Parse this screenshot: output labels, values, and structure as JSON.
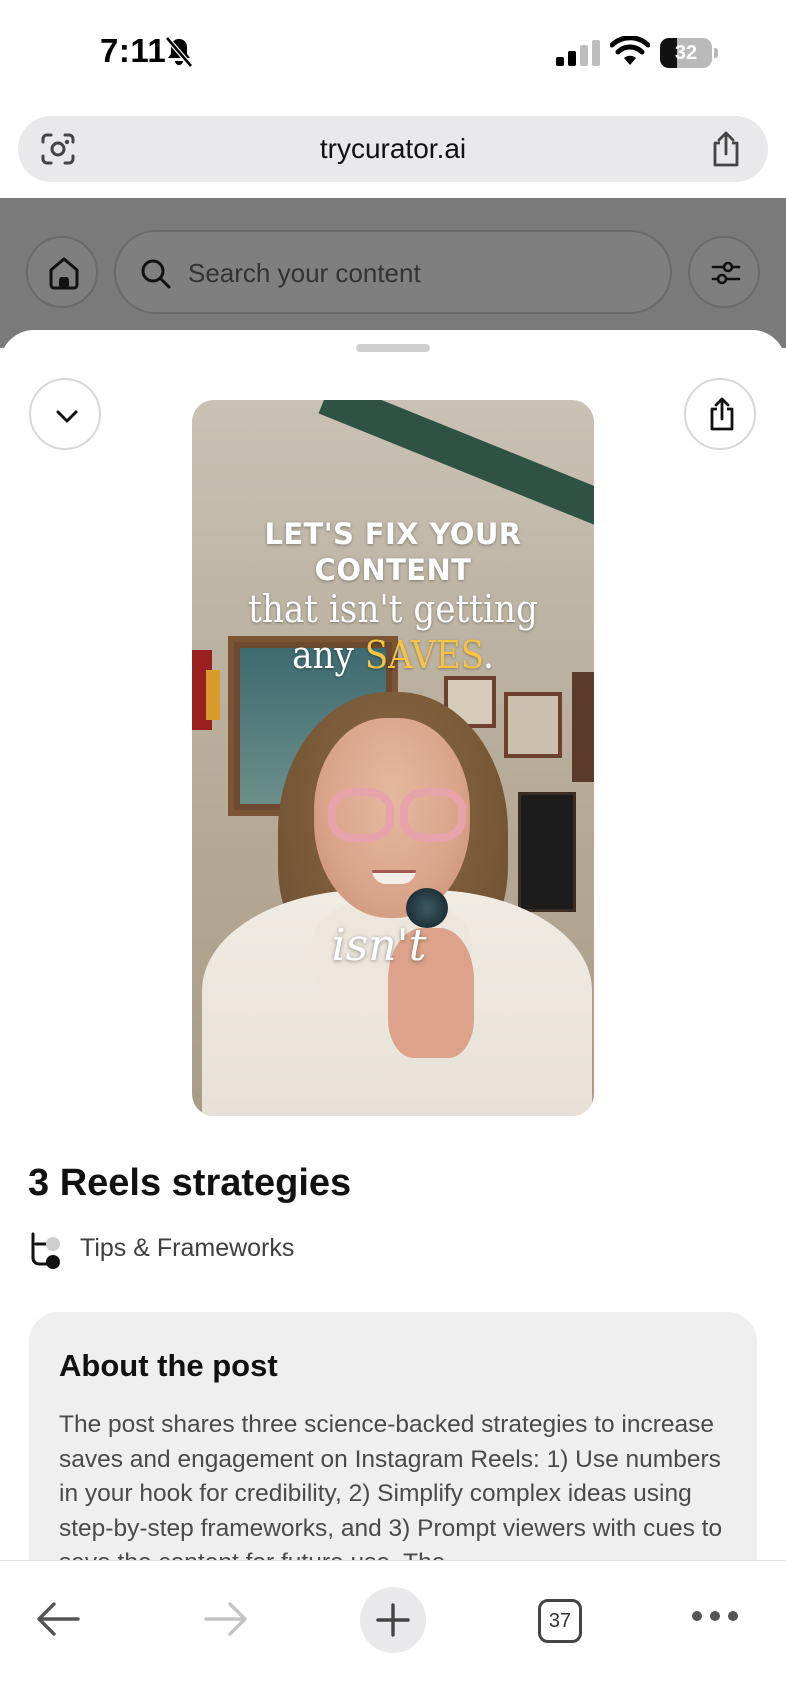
{
  "status_bar": {
    "time": "7:11",
    "battery": "32",
    "battery_level": 0.32
  },
  "browser": {
    "url": "trycurator.ai",
    "tab_count": "37"
  },
  "app_header": {
    "search_placeholder": "Search your content"
  },
  "video": {
    "overlay_line1": "LET'S FIX YOUR",
    "overlay_line2": "CONTENT",
    "overlay_line3": "that isn't getting",
    "overlay_line4a": "any ",
    "overlay_line4b": "SAVES",
    "overlay_line4c": ".",
    "caption_word": "isn't"
  },
  "post": {
    "title": "3 Reels strategies",
    "category": "Tips & Frameworks"
  },
  "about": {
    "heading": "About the post",
    "body": "The post shares three science-backed strategies to increase saves and engagement on Instagram Reels: 1) Use numbers in your hook for credibility, 2) Simplify complex ideas using step-by-step frameworks, and 3) Prompt viewers with cues to save the content for future use. The"
  },
  "colors": {
    "accent": "#f6c343",
    "overlay_dim": "#7a7a7a",
    "card_bg": "#efefef"
  },
  "icons": [
    "bell-slash-icon",
    "signal-icon",
    "wifi-icon",
    "lens-icon",
    "share-icon",
    "home-icon",
    "search-icon",
    "filter-icon",
    "chevron-down-icon",
    "category-icon",
    "back-arrow-icon",
    "forward-arrow-icon",
    "plus-icon",
    "tabs-icon",
    "more-icon"
  ]
}
